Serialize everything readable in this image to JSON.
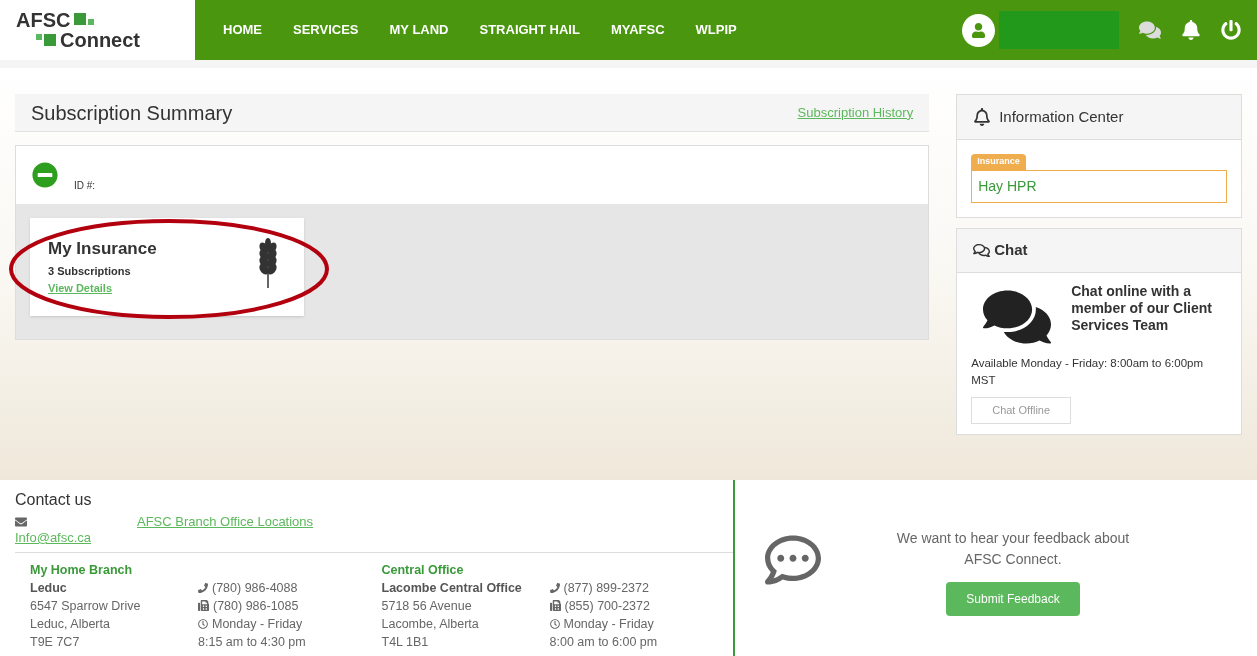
{
  "logo": {
    "line1": "AFSC",
    "line2": "Connect"
  },
  "nav": [
    {
      "label": "HOME"
    },
    {
      "label": "SERVICES"
    },
    {
      "label": "MY LAND"
    },
    {
      "label": "STRAIGHT HAIL"
    },
    {
      "label": "MYAFSC"
    },
    {
      "label": "WLPIP"
    }
  ],
  "summary": {
    "title": "Subscription Summary",
    "history_link": "Subscription History",
    "account": {
      "expanded": true,
      "id_label": "ID #:"
    },
    "cards": [
      {
        "title": "My Insurance",
        "subtitle": "3 Subscriptions",
        "link": "View Details",
        "highlighted": true
      }
    ]
  },
  "info_center": {
    "title": "Information Center",
    "items": [
      {
        "tag": "Insurance",
        "text": "Hay HPR"
      }
    ]
  },
  "chat": {
    "title": "Chat",
    "message": "Chat online with a member of our Client Services Team",
    "availability": "Available Monday - Friday: 8:00am to 6:00pm MST",
    "button": "Chat Offline",
    "online": false
  },
  "contact": {
    "title": "Contact us",
    "email": "Info@afsc.ca",
    "locations_link": "AFSC Branch Office Locations",
    "offices": [
      {
        "heading": "My Home Branch",
        "name": "Leduc",
        "address": [
          "6547 Sparrow Drive",
          "Leduc, Alberta",
          "T9E 7C7"
        ],
        "phone": "(780) 986-4088",
        "fax": "(780) 986-1085",
        "days": "Monday - Friday",
        "hours": "8:15 am to 4:30 pm"
      },
      {
        "heading": "Central Office",
        "name": "Lacombe Central Office",
        "address": [
          "5718 56 Avenue",
          "Lacombe, Alberta",
          "T4L 1B1"
        ],
        "phone": "(877) 899-2372",
        "fax": "(855) 700-2372",
        "days": "Monday - Friday",
        "hours": "8:00 am to 6:00 pm"
      }
    ]
  },
  "feedback": {
    "message": "We want to hear your feedback about AFSC Connect.",
    "button": "Submit Feedback"
  }
}
